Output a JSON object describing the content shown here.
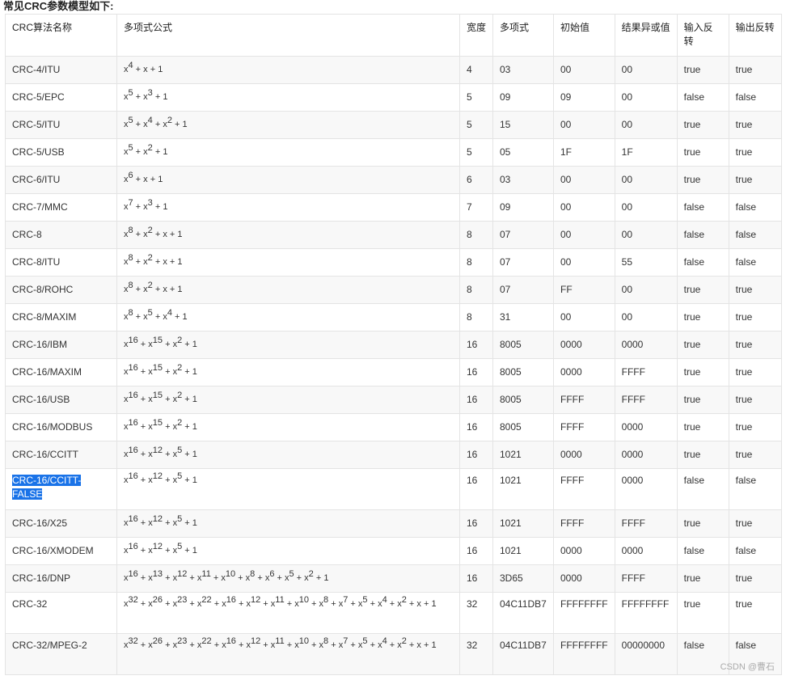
{
  "heading": "常见CRC参数模型如下:",
  "columns": [
    "CRC算法名称",
    "多项式公式",
    "宽度",
    "多项式",
    "初始值",
    "结果异或值",
    "输入反转",
    "输出反转"
  ],
  "rows": [
    {
      "name": "CRC-4/ITU",
      "formula": [
        [
          "x",
          "4"
        ],
        [
          "x",
          ""
        ],
        [
          "1",
          ""
        ]
      ],
      "width": "4",
      "poly": "03",
      "init": "00",
      "xorout": "00",
      "refin": "true",
      "refout": "true"
    },
    {
      "name": "CRC-5/EPC",
      "formula": [
        [
          "x",
          "5"
        ],
        [
          "x",
          "3"
        ],
        [
          "1",
          ""
        ]
      ],
      "width": "5",
      "poly": "09",
      "init": "09",
      "xorout": "00",
      "refin": "false",
      "refout": "false"
    },
    {
      "name": "CRC-5/ITU",
      "formula": [
        [
          "x",
          "5"
        ],
        [
          "x",
          "4"
        ],
        [
          "x",
          "2"
        ],
        [
          "1",
          ""
        ]
      ],
      "width": "5",
      "poly": "15",
      "init": "00",
      "xorout": "00",
      "refin": "true",
      "refout": "true"
    },
    {
      "name": "CRC-5/USB",
      "formula": [
        [
          "x",
          "5"
        ],
        [
          "x",
          "2"
        ],
        [
          "1",
          ""
        ]
      ],
      "width": "5",
      "poly": "05",
      "init": "1F",
      "xorout": "1F",
      "refin": "true",
      "refout": "true"
    },
    {
      "name": "CRC-6/ITU",
      "formula": [
        [
          "x",
          "6"
        ],
        [
          "x",
          ""
        ],
        [
          "1",
          ""
        ]
      ],
      "width": "6",
      "poly": "03",
      "init": "00",
      "xorout": "00",
      "refin": "true",
      "refout": "true"
    },
    {
      "name": "CRC-7/MMC",
      "formula": [
        [
          "x",
          "7"
        ],
        [
          "x",
          "3"
        ],
        [
          "1",
          ""
        ]
      ],
      "width": "7",
      "poly": "09",
      "init": "00",
      "xorout": "00",
      "refin": "false",
      "refout": "false"
    },
    {
      "name": "CRC-8",
      "formula": [
        [
          "x",
          "8"
        ],
        [
          "x",
          "2"
        ],
        [
          "x",
          ""
        ],
        [
          "1",
          ""
        ]
      ],
      "width": "8",
      "poly": "07",
      "init": "00",
      "xorout": "00",
      "refin": "false",
      "refout": "false"
    },
    {
      "name": "CRC-8/ITU",
      "formula": [
        [
          "x",
          "8"
        ],
        [
          "x",
          "2"
        ],
        [
          "x",
          ""
        ],
        [
          "1",
          ""
        ]
      ],
      "width": "8",
      "poly": "07",
      "init": "00",
      "xorout": "55",
      "refin": "false",
      "refout": "false"
    },
    {
      "name": "CRC-8/ROHC",
      "formula": [
        [
          "x",
          "8"
        ],
        [
          "x",
          "2"
        ],
        [
          "x",
          ""
        ],
        [
          "1",
          ""
        ]
      ],
      "width": "8",
      "poly": "07",
      "init": "FF",
      "xorout": "00",
      "refin": "true",
      "refout": "true"
    },
    {
      "name": "CRC-8/MAXIM",
      "formula": [
        [
          "x",
          "8"
        ],
        [
          "x",
          "5"
        ],
        [
          "x",
          "4"
        ],
        [
          "1",
          ""
        ]
      ],
      "width": "8",
      "poly": "31",
      "init": "00",
      "xorout": "00",
      "refin": "true",
      "refout": "true"
    },
    {
      "name": "CRC-16/IBM",
      "formula": [
        [
          "x",
          "16"
        ],
        [
          "x",
          "15"
        ],
        [
          "x",
          "2"
        ],
        [
          "1",
          ""
        ]
      ],
      "width": "16",
      "poly": "8005",
      "init": "0000",
      "xorout": "0000",
      "refin": "true",
      "refout": "true"
    },
    {
      "name": "CRC-16/MAXIM",
      "formula": [
        [
          "x",
          "16"
        ],
        [
          "x",
          "15"
        ],
        [
          "x",
          "2"
        ],
        [
          "1",
          ""
        ]
      ],
      "width": "16",
      "poly": "8005",
      "init": "0000",
      "xorout": "FFFF",
      "refin": "true",
      "refout": "true"
    },
    {
      "name": "CRC-16/USB",
      "formula": [
        [
          "x",
          "16"
        ],
        [
          "x",
          "15"
        ],
        [
          "x",
          "2"
        ],
        [
          "1",
          ""
        ]
      ],
      "width": "16",
      "poly": "8005",
      "init": "FFFF",
      "xorout": "FFFF",
      "refin": "true",
      "refout": "true"
    },
    {
      "name": "CRC-16/MODBUS",
      "formula": [
        [
          "x",
          "16"
        ],
        [
          "x",
          "15"
        ],
        [
          "x",
          "2"
        ],
        [
          "1",
          ""
        ]
      ],
      "width": "16",
      "poly": "8005",
      "init": "FFFF",
      "xorout": "0000",
      "refin": "true",
      "refout": "true"
    },
    {
      "name": "CRC-16/CCITT",
      "formula": [
        [
          "x",
          "16"
        ],
        [
          "x",
          "12"
        ],
        [
          "x",
          "5"
        ],
        [
          "1",
          ""
        ]
      ],
      "width": "16",
      "poly": "1021",
      "init": "0000",
      "xorout": "0000",
      "refin": "true",
      "refout": "true"
    },
    {
      "name": "CRC-16/CCITT-FALSE",
      "name_lines": [
        "CRC-16/CCITT-",
        "FALSE"
      ],
      "selected": true,
      "formula": [
        [
          "x",
          "16"
        ],
        [
          "x",
          "12"
        ],
        [
          "x",
          "5"
        ],
        [
          "1",
          ""
        ]
      ],
      "width": "16",
      "poly": "1021",
      "init": "FFFF",
      "xorout": "0000",
      "refin": "false",
      "refout": "false"
    },
    {
      "name": "CRC-16/X25",
      "formula": [
        [
          "x",
          "16"
        ],
        [
          "x",
          "12"
        ],
        [
          "x",
          "5"
        ],
        [
          "1",
          ""
        ]
      ],
      "width": "16",
      "poly": "1021",
      "init": "FFFF",
      "xorout": "FFFF",
      "refin": "true",
      "refout": "true"
    },
    {
      "name": "CRC-16/XMODEM",
      "formula": [
        [
          "x",
          "16"
        ],
        [
          "x",
          "12"
        ],
        [
          "x",
          "5"
        ],
        [
          "1",
          ""
        ]
      ],
      "width": "16",
      "poly": "1021",
      "init": "0000",
      "xorout": "0000",
      "refin": "false",
      "refout": "false"
    },
    {
      "name": "CRC-16/DNP",
      "formula": [
        [
          "x",
          "16"
        ],
        [
          "x",
          "13"
        ],
        [
          "x",
          "12"
        ],
        [
          "x",
          "11"
        ],
        [
          "x",
          "10"
        ],
        [
          "x",
          "8"
        ],
        [
          "x",
          "6"
        ],
        [
          "x",
          "5"
        ],
        [
          "x",
          "2"
        ],
        [
          "1",
          ""
        ]
      ],
      "width": "16",
      "poly": "3D65",
      "init": "0000",
      "xorout": "FFFF",
      "refin": "true",
      "refout": "true"
    },
    {
      "name": "CRC-32",
      "formula": [
        [
          "x",
          "32"
        ],
        [
          "x",
          "26"
        ],
        [
          "x",
          "23"
        ],
        [
          "x",
          "22"
        ],
        [
          "x",
          "16"
        ],
        [
          "x",
          "12"
        ],
        [
          "x",
          "11"
        ],
        [
          "x",
          "10"
        ],
        [
          "x",
          "8"
        ],
        [
          "x",
          "7"
        ],
        [
          "x",
          "5"
        ],
        [
          "x",
          "4"
        ],
        [
          "x",
          "2"
        ],
        [
          "x",
          ""
        ],
        [
          "1",
          ""
        ]
      ],
      "width": "32",
      "poly": "04C11DB7",
      "init": "FFFFFFFF",
      "xorout": "FFFFFFFF",
      "refin": "true",
      "refout": "true"
    },
    {
      "name": "CRC-32/MPEG-2",
      "formula": [
        [
          "x",
          "32"
        ],
        [
          "x",
          "26"
        ],
        [
          "x",
          "23"
        ],
        [
          "x",
          "22"
        ],
        [
          "x",
          "16"
        ],
        [
          "x",
          "12"
        ],
        [
          "x",
          "11"
        ],
        [
          "x",
          "10"
        ],
        [
          "x",
          "8"
        ],
        [
          "x",
          "7"
        ],
        [
          "x",
          "5"
        ],
        [
          "x",
          "4"
        ],
        [
          "x",
          "2"
        ],
        [
          "x",
          ""
        ],
        [
          "1",
          ""
        ]
      ],
      "width": "32",
      "poly": "04C11DB7",
      "init": "FFFFFFFF",
      "xorout": "00000000",
      "refin": "false",
      "refout": "false"
    }
  ],
  "watermark": "CSDN @曹石",
  "colors": {
    "border": "#e4e4e4",
    "row_alt": "#f8f8f8",
    "highlight": "#1a73e8"
  }
}
